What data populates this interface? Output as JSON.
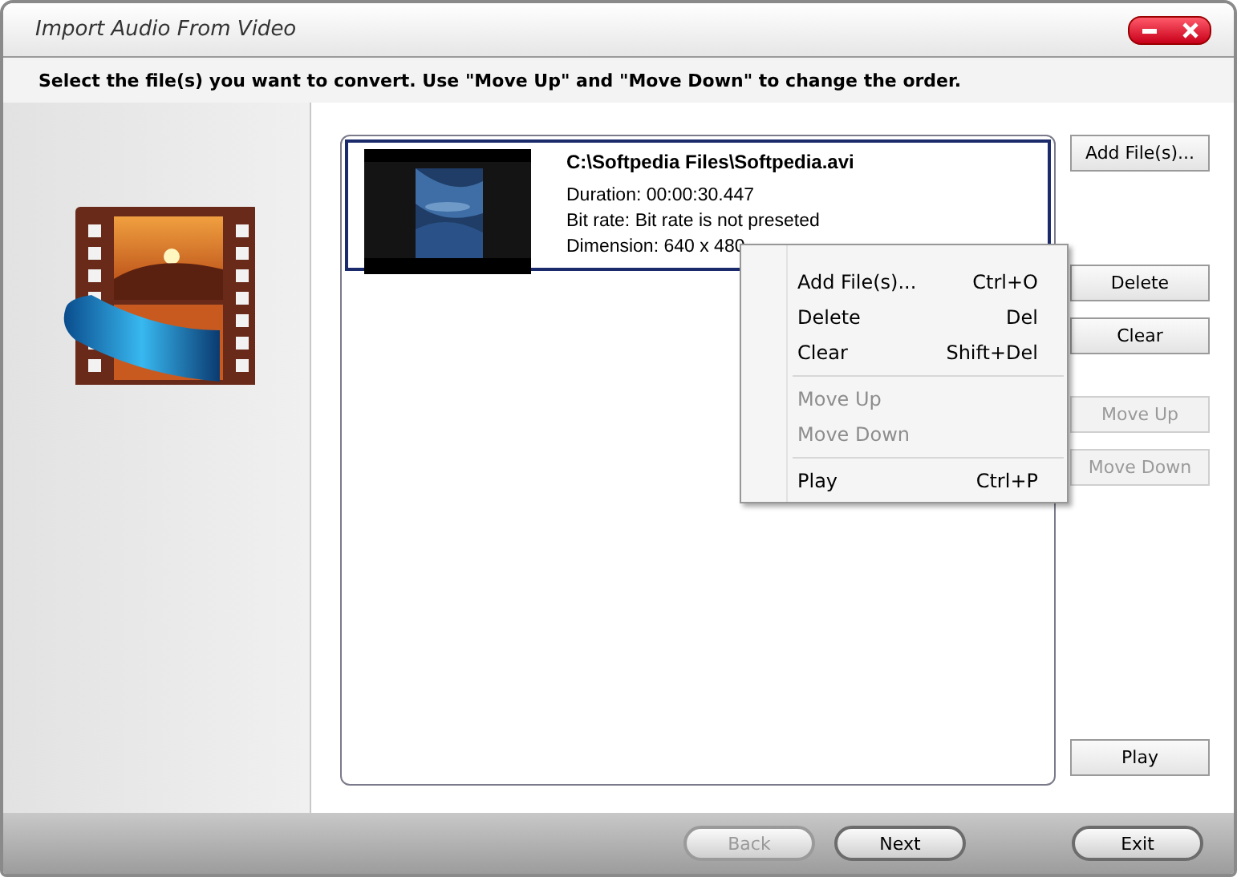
{
  "window": {
    "title": "Import Audio From Video"
  },
  "instruction": "Select the file(s) you want to convert. Use \"Move Up\" and \"Move Down\" to change the order.",
  "files": [
    {
      "path": "C:\\Softpedia Files\\Softpedia.avi",
      "duration": "Duration: 00:00:30.447",
      "bitrate": "Bit rate: Bit rate is not preseted",
      "dimension": "Dimension: 640 x 480",
      "selected": true
    }
  ],
  "side_buttons": [
    {
      "label": "Add File(s)...",
      "disabled": false
    },
    {
      "label": "Delete",
      "disabled": false
    },
    {
      "label": "Clear",
      "disabled": false
    },
    {
      "label": "Move Up",
      "disabled": true
    },
    {
      "label": "Move Down",
      "disabled": true
    },
    {
      "label": "Play",
      "disabled": false
    }
  ],
  "context_menu": [
    {
      "kind": "item",
      "label": "Add File(s)...",
      "shortcut": "Ctrl+O",
      "disabled": false
    },
    {
      "kind": "item",
      "label": "Delete",
      "shortcut": "Del",
      "disabled": false
    },
    {
      "kind": "item",
      "label": "Clear",
      "shortcut": "Shift+Del",
      "disabled": false
    },
    {
      "kind": "separator"
    },
    {
      "kind": "item",
      "label": "Move Up",
      "disabled": true
    },
    {
      "kind": "item",
      "label": "Move Down",
      "disabled": true
    },
    {
      "kind": "separator"
    },
    {
      "kind": "item",
      "label": "Play",
      "shortcut": "Ctrl+P",
      "disabled": false
    }
  ],
  "nav_buttons": [
    {
      "label": "Back",
      "disabled": true
    },
    {
      "label": "Next",
      "disabled": false
    },
    {
      "label": "Exit",
      "disabled": false
    }
  ]
}
